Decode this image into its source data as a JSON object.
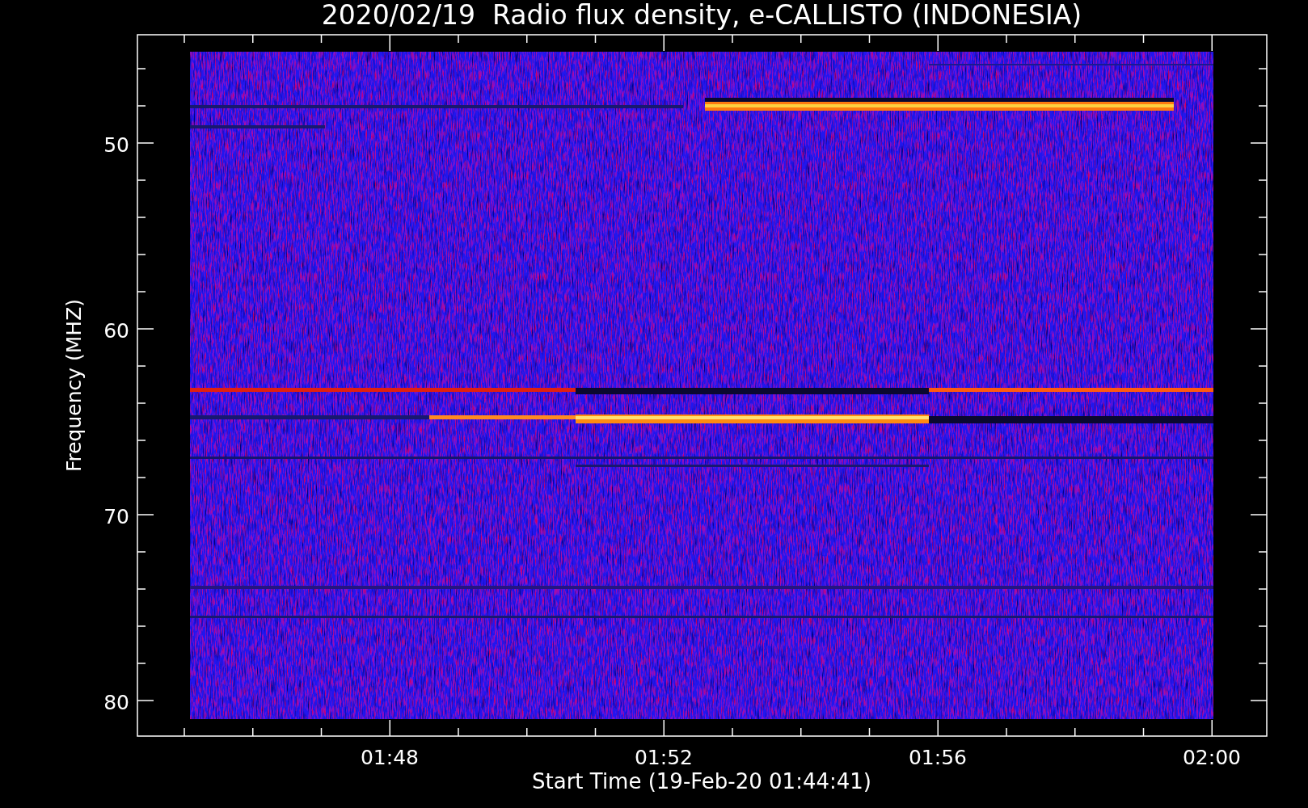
{
  "plot": {
    "title": "2020/02/19  Radio flux density, e-CALLISTO (INDONESIA)",
    "y_axis": {
      "label": "Frequency (MHZ)",
      "ticks": [
        "50",
        "60",
        "70",
        "80"
      ]
    },
    "x_axis": {
      "label": "Start Time (19-Feb-20 01:44:41)",
      "ticks": [
        "01:48",
        "01:52",
        "01:56",
        "02:00"
      ]
    }
  }
}
